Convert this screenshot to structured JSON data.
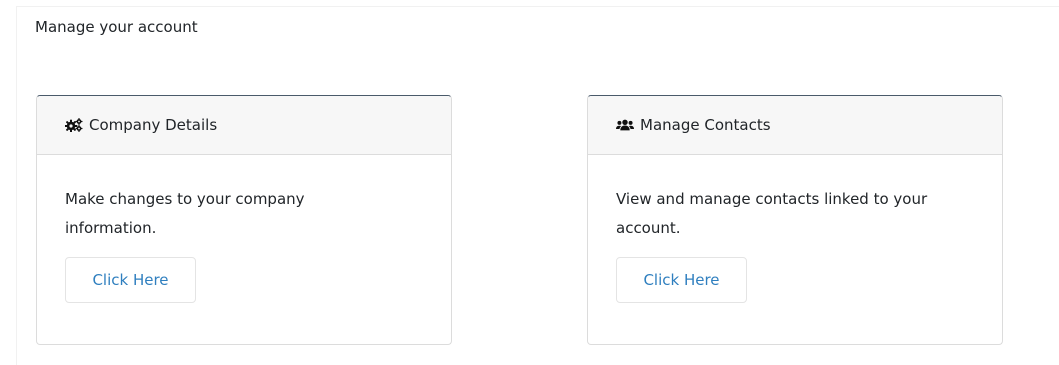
{
  "page": {
    "heading": "Manage your account"
  },
  "cards": [
    {
      "title": "Company Details",
      "icon": "cogs-icon",
      "description": "Make changes to your company information.",
      "button_label": "Click Here"
    },
    {
      "title": "Manage Contacts",
      "icon": "users-icon",
      "description": "View and manage contacts linked to your account.",
      "button_label": "Click Here"
    }
  ],
  "colors": {
    "link": "#2f7fbf",
    "header_bg": "#f7f7f7",
    "border": "#dcdcdc"
  }
}
